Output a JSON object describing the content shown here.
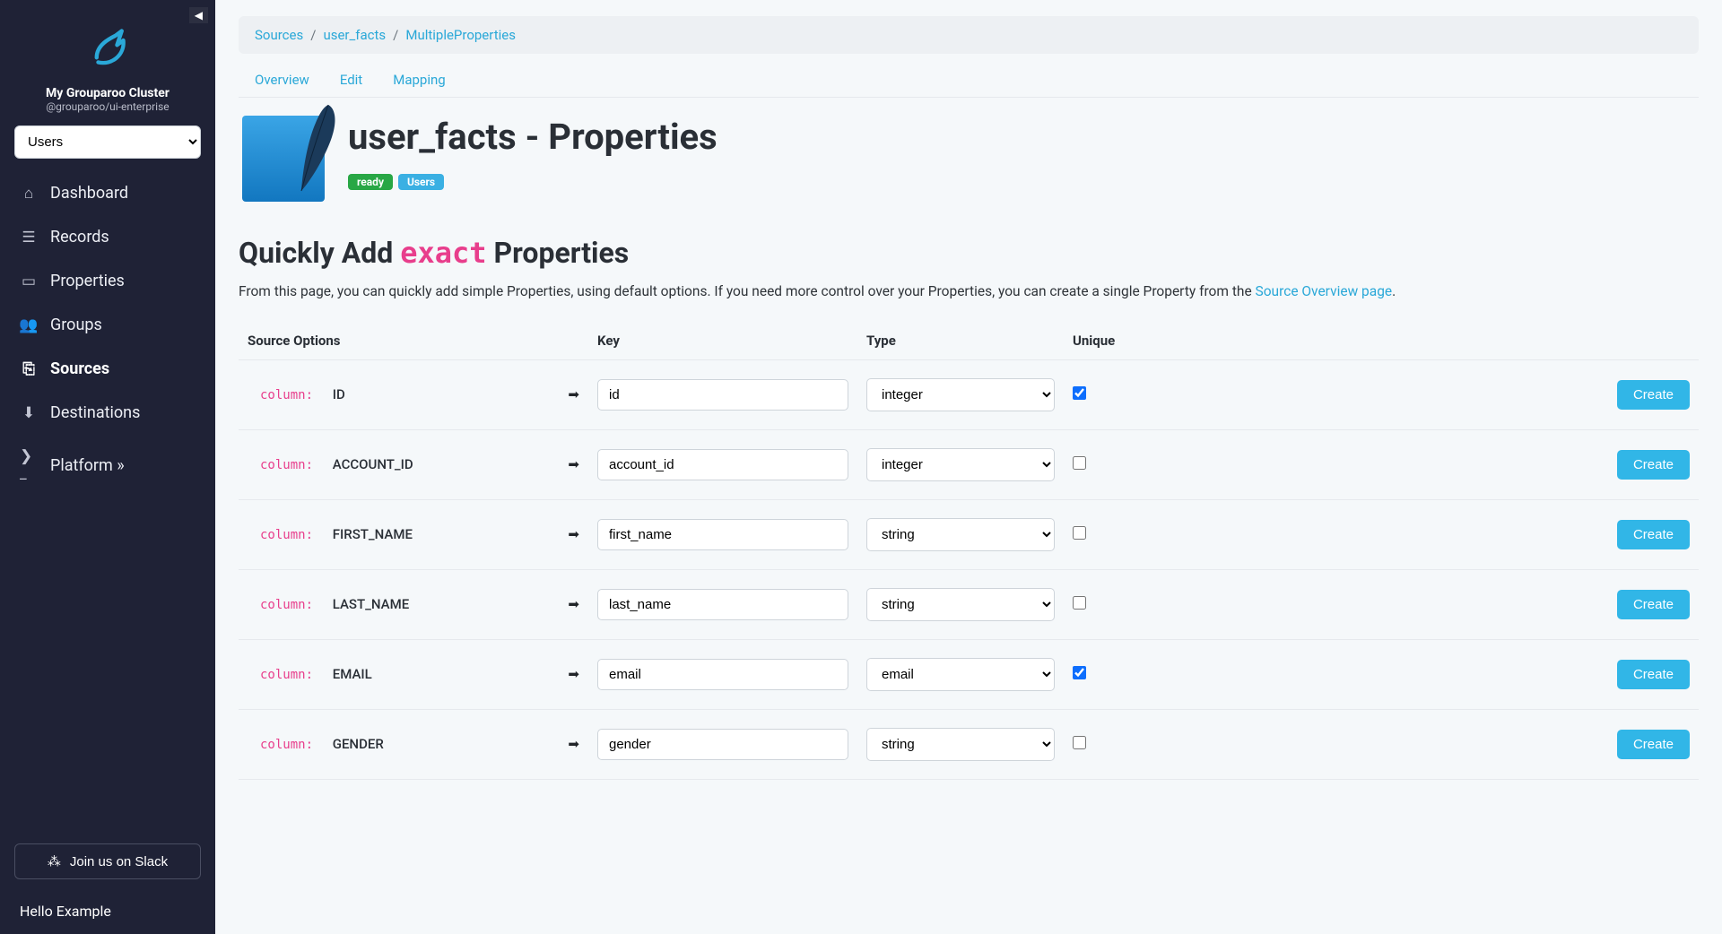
{
  "sidebar": {
    "cluster_name": "My Grouparoo Cluster",
    "cluster_sub": "@grouparoo/ui-enterprise",
    "model_select": "Users",
    "items": [
      {
        "label": "Dashboard",
        "icon": "home-icon",
        "glyph": "⌂",
        "active": false
      },
      {
        "label": "Records",
        "icon": "list-icon",
        "glyph": "☰",
        "active": false
      },
      {
        "label": "Properties",
        "icon": "card-icon",
        "glyph": "▭",
        "active": false
      },
      {
        "label": "Groups",
        "icon": "users-icon",
        "glyph": "👥",
        "active": false
      },
      {
        "label": "Sources",
        "icon": "export-icon",
        "glyph": "⎘",
        "active": true
      },
      {
        "label": "Destinations",
        "icon": "import-icon",
        "glyph": "⬇",
        "active": false
      },
      {
        "label": "Platform »",
        "icon": "terminal-icon",
        "glyph": "❯_",
        "active": false
      }
    ],
    "slack_label": "Join us on Slack",
    "hello": "Hello Example"
  },
  "breadcrumbs": {
    "items": [
      "Sources",
      "user_facts",
      "MultipleProperties"
    ]
  },
  "tabs": {
    "items": [
      "Overview",
      "Edit",
      "Mapping"
    ]
  },
  "header": {
    "title": "user_facts - Properties",
    "badges": {
      "ready": "ready",
      "users": "Users"
    }
  },
  "section": {
    "title_prefix": "Quickly Add ",
    "title_code": "exact",
    "title_suffix": " Properties",
    "desc_prefix": "From this page, you can quickly add simple Properties, using default options. If you need more control over your Properties, you can create a single Property from the ",
    "desc_link": "Source Overview page",
    "desc_suffix": "."
  },
  "table": {
    "headers": {
      "src": "Source Options",
      "key": "Key",
      "type": "Type",
      "unique": "Unique"
    },
    "column_label": "column:",
    "arrow": "➡",
    "create_label": "Create"
  },
  "rows": [
    {
      "name": "ID",
      "key": "id",
      "type": "integer",
      "unique": true
    },
    {
      "name": "ACCOUNT_ID",
      "key": "account_id",
      "type": "integer",
      "unique": false
    },
    {
      "name": "FIRST_NAME",
      "key": "first_name",
      "type": "string",
      "unique": false
    },
    {
      "name": "LAST_NAME",
      "key": "last_name",
      "type": "string",
      "unique": false
    },
    {
      "name": "EMAIL",
      "key": "email",
      "type": "email",
      "unique": true
    },
    {
      "name": "GENDER",
      "key": "gender",
      "type": "string",
      "unique": false
    }
  ]
}
